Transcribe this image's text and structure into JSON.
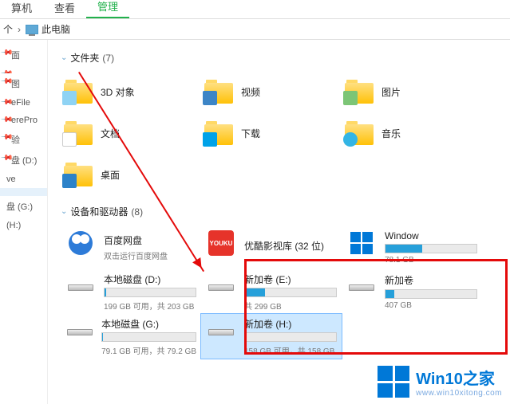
{
  "ribbon": {
    "tabs": [
      {
        "label": "算机"
      },
      {
        "label": "查看"
      },
      {
        "label": "管理",
        "active": true
      }
    ]
  },
  "breadcrumb": {
    "up_label": "个",
    "location": "此电脑"
  },
  "sidebar": {
    "items": [
      {
        "label": "面",
        "pinned": true
      },
      {
        "label": "",
        "pinned": true
      },
      {
        "label": "图",
        "pinned": true
      },
      {
        "label": "eFile",
        "pinned": true
      },
      {
        "label": "erePro",
        "pinned": true
      },
      {
        "label": "验",
        "pinned": true
      },
      {
        "label": "盘 (D:)",
        "pinned": true
      },
      {
        "label": "ve",
        "pinned": false
      },
      {
        "label": "",
        "pinned": false,
        "sel": true
      },
      {
        "label": "盘 (G:)",
        "pinned": false
      },
      {
        "label": "(H:)",
        "pinned": false
      }
    ]
  },
  "groups": {
    "folders": {
      "title": "文件夹",
      "count": "(7)"
    },
    "devices": {
      "title": "设备和驱动器",
      "count": "(8)"
    }
  },
  "folders": [
    {
      "label": "3D 对象",
      "badge": "b-3d"
    },
    {
      "label": "视频",
      "badge": "b-video"
    },
    {
      "label": "图片",
      "badge": "b-pic"
    },
    {
      "label": "文档",
      "badge": "b-doc"
    },
    {
      "label": "下载",
      "badge": "b-dl"
    },
    {
      "label": "音乐",
      "badge": "b-music"
    },
    {
      "label": "桌面",
      "badge": "b-desk"
    }
  ],
  "drives": [
    {
      "title": "百度网盘",
      "sub": "双击运行百度网盘",
      "icon": "baidu",
      "bar": false
    },
    {
      "title": "优酷影视库 (32 位)",
      "sub": "",
      "icon": "youku",
      "bar": false
    },
    {
      "title": "Window",
      "sub": "78.1 GB",
      "icon": "win",
      "bar": true,
      "fill": 40
    },
    {
      "title": "本地磁盘 (D:)",
      "sub": "199 GB 可用，共 203 GB",
      "icon": "disk",
      "bar": true,
      "fill": 2
    },
    {
      "title": "新加卷 (E:)",
      "sub": "共 299 GB",
      "icon": "disk",
      "bar": true,
      "fill": 22
    },
    {
      "title": "新加卷",
      "sub": "407 GB",
      "icon": "disk",
      "bar": true,
      "fill": 10
    },
    {
      "title": "本地磁盘 (G:)",
      "sub": "79.1 GB 可用，共 79.2 GB",
      "icon": "disk",
      "bar": true,
      "fill": 1
    },
    {
      "title": "新加卷 (H:)",
      "sub": "158 GB 可用，共 158 GB",
      "icon": "disk",
      "bar": true,
      "fill": 1,
      "selected": true
    }
  ],
  "watermark": {
    "title": "Win10之家",
    "url": "www.win10xitong.com"
  }
}
